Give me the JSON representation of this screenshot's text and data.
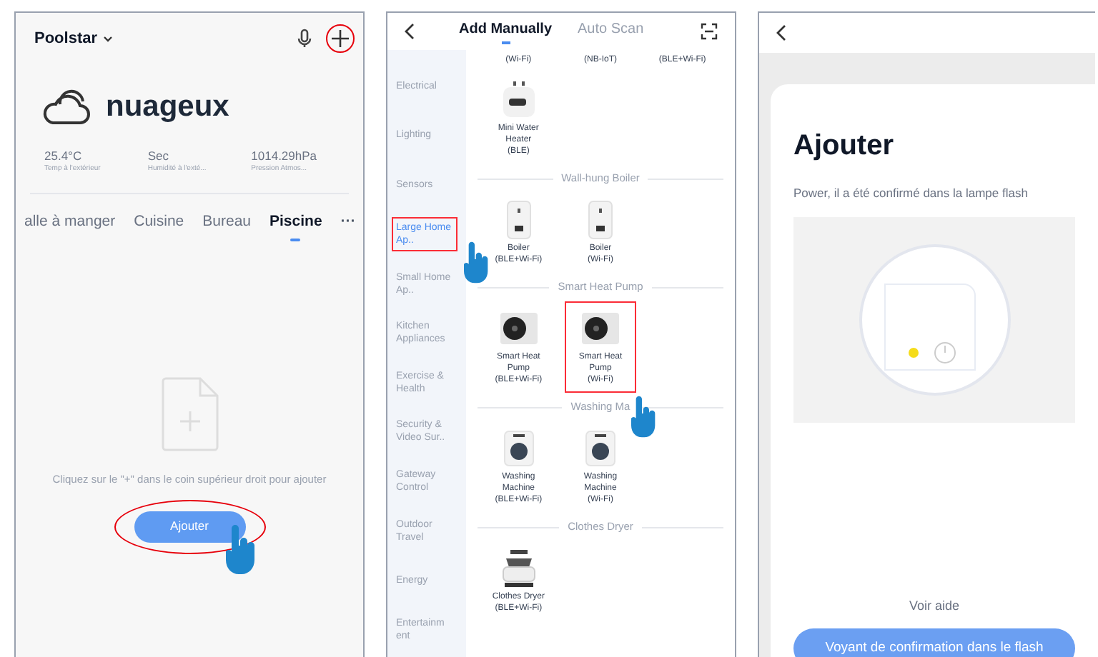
{
  "home_screen": {
    "home_name": "Poolstar",
    "weather": {
      "condition": "nuageux",
      "stats": [
        {
          "value": "25.4°C",
          "label": "Temp à l'extérieur"
        },
        {
          "value": "Sec",
          "label": "Humidité à l'exté..."
        },
        {
          "value": "1014.29hPa",
          "label": "Pression Atmos..."
        }
      ]
    },
    "rooms": [
      {
        "label": "alle à manger",
        "selected": false
      },
      {
        "label": "Cuisine",
        "selected": false
      },
      {
        "label": "Bureau",
        "selected": false
      },
      {
        "label": "Piscine",
        "selected": true
      }
    ],
    "more": "···",
    "empty_message": "Cliquez sur le \"+\" dans le coin supérieur droit pour ajouter",
    "add_button": "Ajouter"
  },
  "add_device_screen": {
    "tabs": [
      {
        "label": "Add Manually",
        "selected": true
      },
      {
        "label": "Auto Scan",
        "selected": false
      }
    ],
    "categories": [
      {
        "label": "Electrical",
        "selected": false,
        "highlighted": false
      },
      {
        "label": "Lighting",
        "selected": false,
        "highlighted": false
      },
      {
        "label": "Sensors",
        "selected": false,
        "highlighted": false
      },
      {
        "label": "Large Home Ap..",
        "selected": true,
        "highlighted": true
      },
      {
        "label": "Small Home Ap..",
        "selected": false,
        "highlighted": false
      },
      {
        "label": "Kitchen Appliances",
        "selected": false,
        "highlighted": false
      },
      {
        "label": "Exercise & Health",
        "selected": false,
        "highlighted": false
      },
      {
        "label": "Security & Video Sur..",
        "selected": false,
        "highlighted": false
      },
      {
        "label": "Gateway Control",
        "selected": false,
        "highlighted": false
      },
      {
        "label": "Outdoor Travel",
        "selected": false,
        "highlighted": false
      },
      {
        "label": "Energy",
        "selected": false,
        "highlighted": false
      },
      {
        "label": "Entertainm ent",
        "selected": false,
        "highlighted": false
      }
    ],
    "sections": [
      {
        "devices": [
          {
            "kind": "cut",
            "protocol": "(Wi-Fi)",
            "highlighted": false
          },
          {
            "kind": "cut",
            "protocol": "(NB-IoT)",
            "highlighted": false
          },
          {
            "kind": "cut",
            "protocol": "(BLE+Wi-Fi)",
            "highlighted": false
          },
          {
            "kind": "water_heater",
            "name": "Mini Water Heater",
            "protocol": "(BLE)",
            "highlighted": false
          }
        ]
      },
      {
        "title": "Wall-hung Boiler",
        "devices": [
          {
            "kind": "boiler",
            "name": "Boiler",
            "protocol": "(BLE+Wi-Fi)",
            "highlighted": false
          },
          {
            "kind": "boiler",
            "name": "Boiler",
            "protocol": "(Wi-Fi)",
            "highlighted": false
          }
        ]
      },
      {
        "title": "Smart Heat Pump",
        "devices": [
          {
            "kind": "heat_pump",
            "name": "Smart Heat Pump",
            "protocol": "(BLE+Wi-Fi)",
            "highlighted": false
          },
          {
            "kind": "heat_pump",
            "name": "Smart Heat Pump",
            "protocol": "(Wi-Fi)",
            "highlighted": true
          }
        ]
      },
      {
        "title": "Washing Ma",
        "devices": [
          {
            "kind": "washer",
            "name": "Washing Machine",
            "protocol": "(BLE+Wi-Fi)",
            "highlighted": false
          },
          {
            "kind": "washer",
            "name": "Washing Machine",
            "protocol": "(Wi-Fi)",
            "highlighted": false
          }
        ]
      },
      {
        "title": "Clothes Dryer",
        "devices": [
          {
            "kind": "dryer",
            "name": "Clothes Dryer",
            "protocol": "(BLE+Wi-Fi)",
            "highlighted": false
          }
        ]
      }
    ]
  },
  "confirm_screen": {
    "title": "Ajouter",
    "description": "Power, il a été confirmé dans la lampe flash",
    "help_link": "Voir aide",
    "confirm_button": "Voyant de confirmation dans le flash"
  }
}
